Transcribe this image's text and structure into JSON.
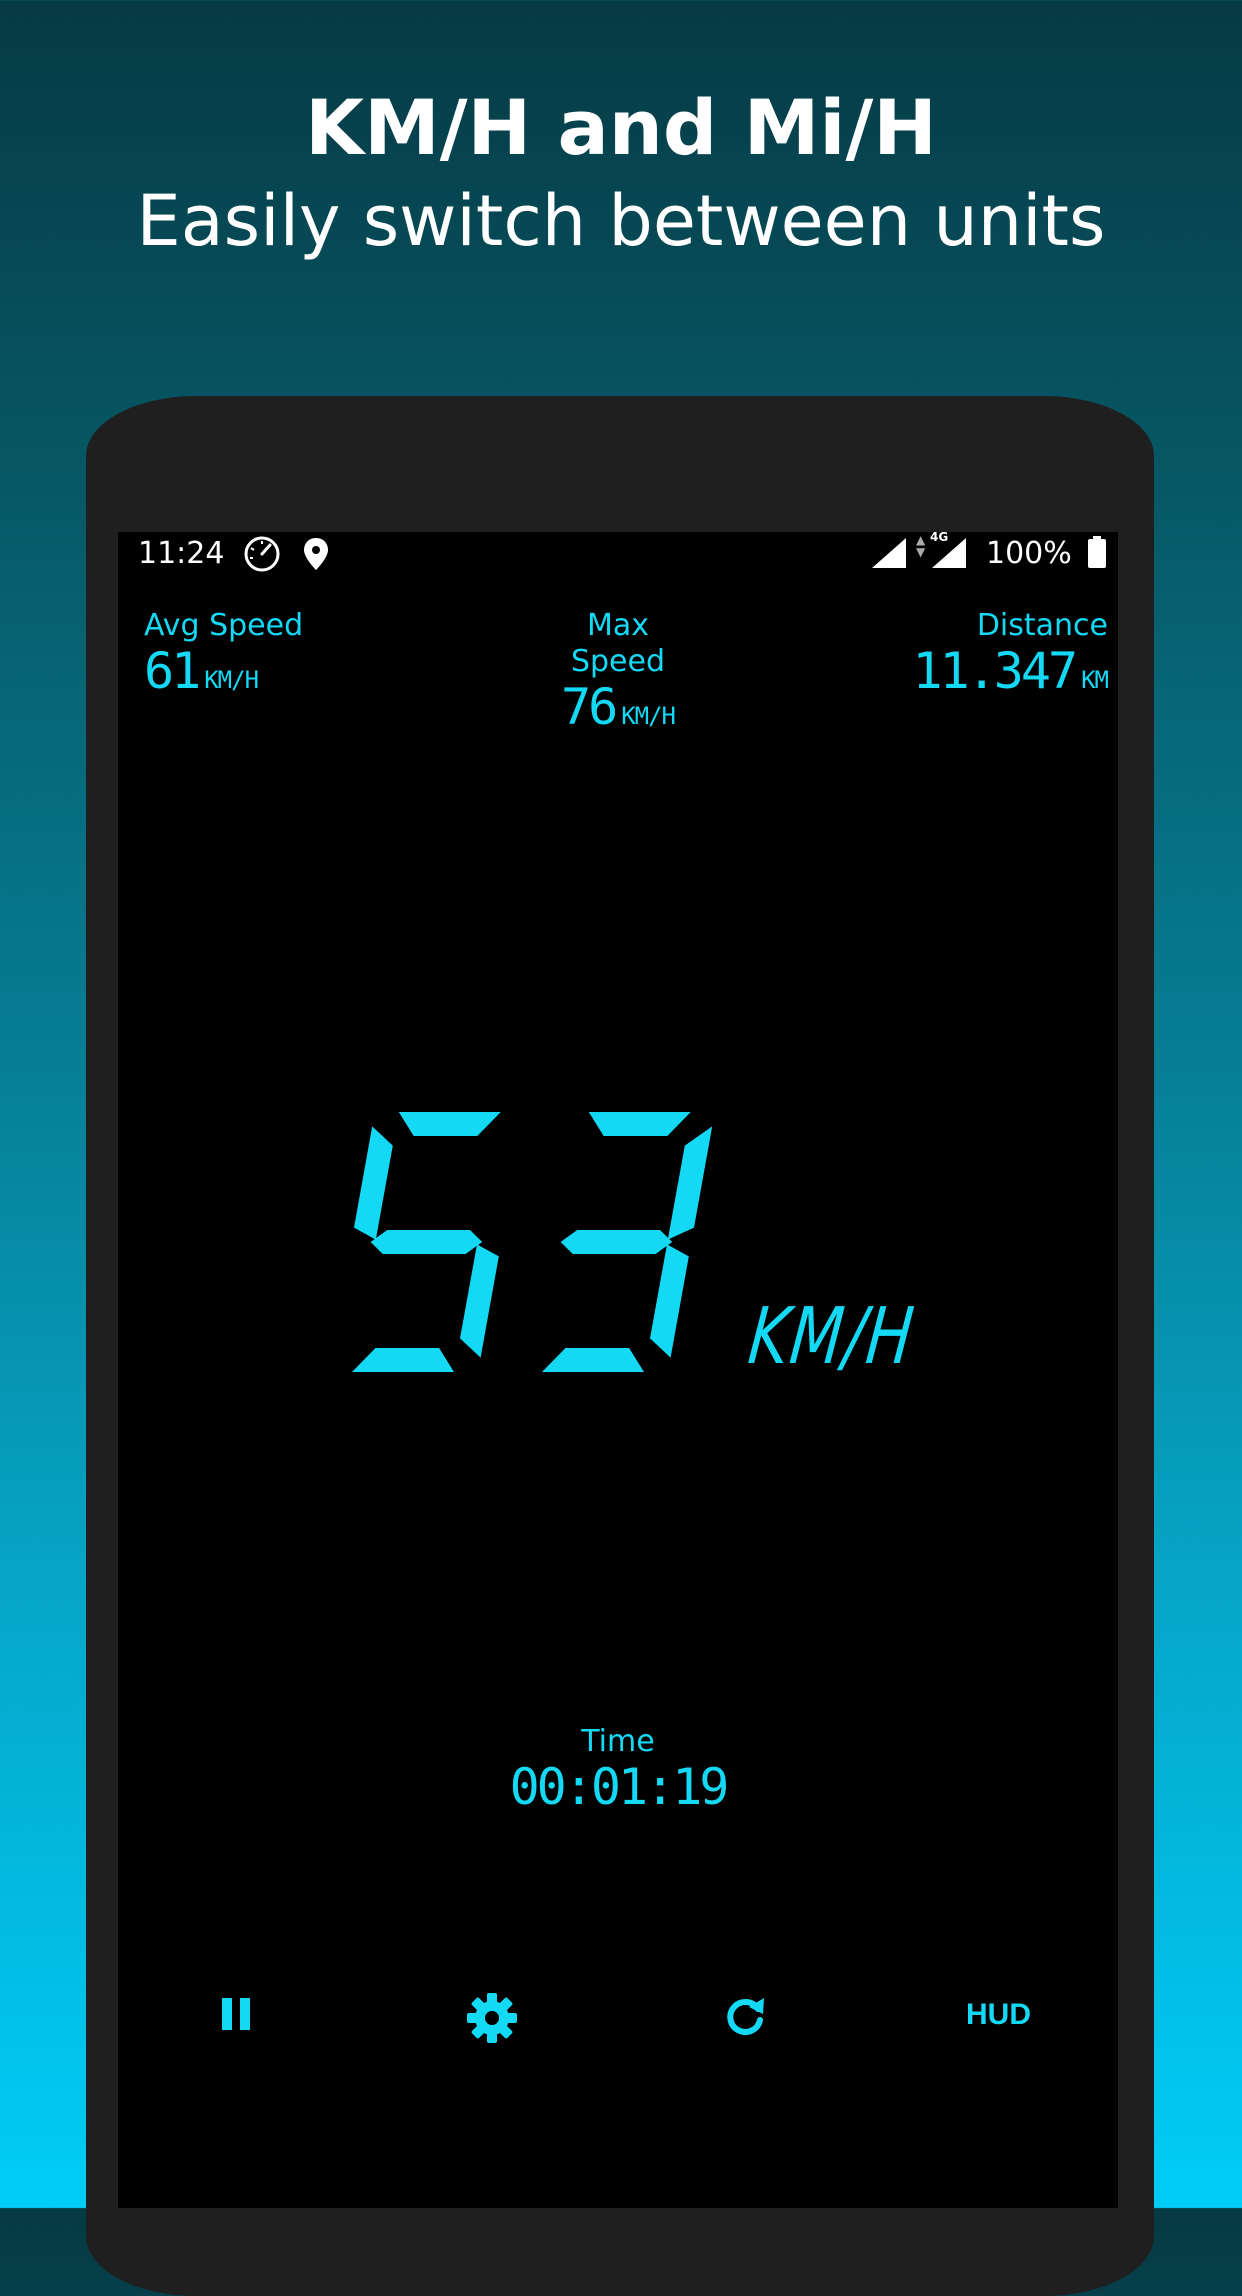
{
  "headline": {
    "title": "KM/H and Mi/H",
    "subtitle": "Easily switch between units"
  },
  "status_bar": {
    "time": "11:24",
    "network": "4G",
    "battery": "100%",
    "icons": [
      "speedometer-icon",
      "location-pin-icon",
      "signal-icon",
      "data-arrows-icon",
      "signal-icon",
      "battery-icon"
    ]
  },
  "stats": {
    "avg_speed": {
      "label": "Avg Speed",
      "value": "61",
      "unit": "KM/H"
    },
    "max_speed": {
      "label": "Max Speed",
      "value": "76",
      "unit": "KM/H"
    },
    "distance": {
      "label": "Distance",
      "value": "11.347",
      "unit": "KM"
    }
  },
  "speed": {
    "value": "53",
    "unit": "KM/H"
  },
  "timer": {
    "label": "Time",
    "value": "00:01:19"
  },
  "controls": {
    "hud_label": "HUD",
    "icons": [
      "pause-icon",
      "gear-icon",
      "refresh-icon"
    ]
  },
  "colors": {
    "accent": "#14d9f5",
    "screen_bg": "#000000",
    "phone_frame": "#1f1f1f",
    "gradient_top": "#063a44",
    "gradient_bottom": "#00cdf8"
  }
}
